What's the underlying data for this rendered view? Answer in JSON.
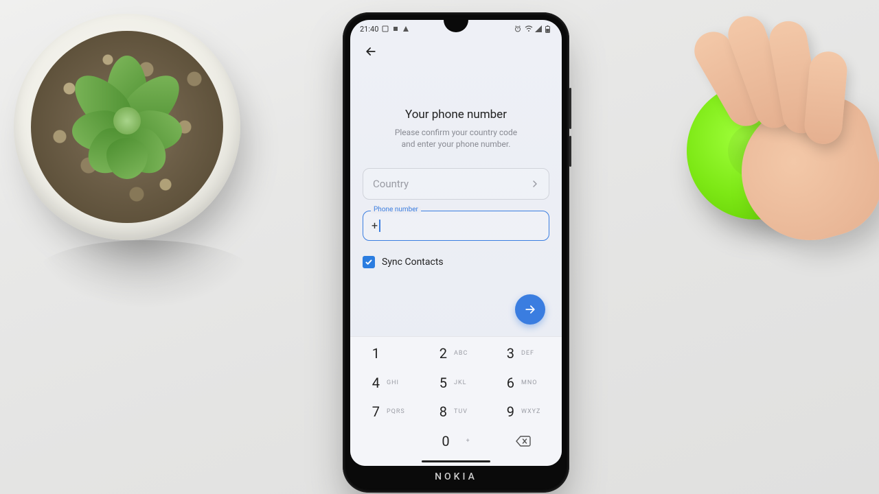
{
  "status": {
    "time": "21:40"
  },
  "screen": {
    "title": "Your phone number",
    "subtitle_line1": "Please confirm your country code",
    "subtitle_line2": "and enter your phone number."
  },
  "country": {
    "label": "Country"
  },
  "phone": {
    "float_label": "Phone number",
    "prefix": "+"
  },
  "sync": {
    "label": "Sync Contacts",
    "checked": true
  },
  "keypad": {
    "keys": [
      {
        "num": "1",
        "letters": ""
      },
      {
        "num": "2",
        "letters": "ABC"
      },
      {
        "num": "3",
        "letters": "DEF"
      },
      {
        "num": "4",
        "letters": "GHI"
      },
      {
        "num": "5",
        "letters": "JKL"
      },
      {
        "num": "6",
        "letters": "MNO"
      },
      {
        "num": "7",
        "letters": "PQRS"
      },
      {
        "num": "8",
        "letters": "TUV"
      },
      {
        "num": "9",
        "letters": "WXYZ"
      },
      {
        "num": "0",
        "letters": "+"
      }
    ]
  },
  "device": {
    "brand": "NOKIA"
  }
}
